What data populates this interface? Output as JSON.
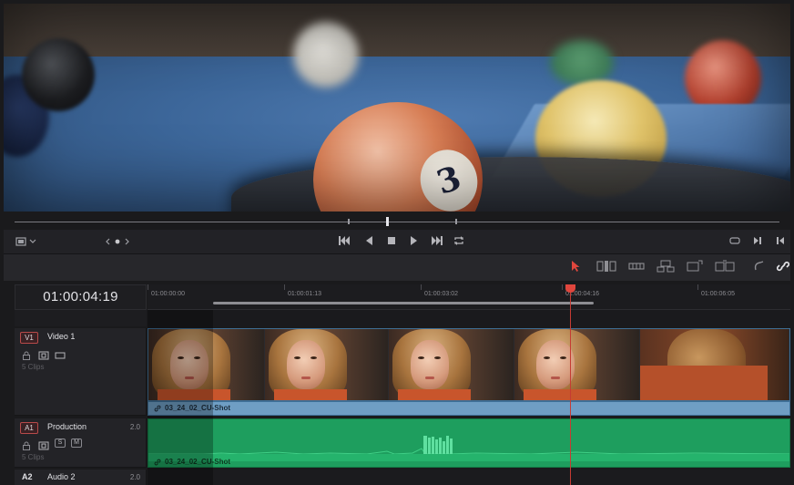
{
  "viewer": {
    "frame_number": "3"
  },
  "toolbar_icons": [
    "selection-arrow-icon",
    "trim-icon",
    "blade-icon",
    "insert-clip-icon",
    "overwrite-clip-icon",
    "replace-clip-icon",
    "snapping-icon",
    "linked-selection-icon"
  ],
  "timecode": {
    "current": "01:00:04:19"
  },
  "ruler": {
    "labels": [
      "01:00:00:00",
      "01:00:01:13",
      "01:00:03:02",
      "01:00:04:16",
      "01:00:06:05"
    ]
  },
  "tracks": {
    "v1": {
      "badge": "V1",
      "name": "Video 1",
      "clips": "5 Clips",
      "clip_name": "03_24_02_CU-Shot"
    },
    "a1": {
      "badge": "A1",
      "name": "Production",
      "channels": "2.0",
      "clips": "5 Clips",
      "clip_name": "03_24_02_CU-Shot",
      "solo": "S",
      "mute": "M"
    },
    "a2": {
      "badge": "A2",
      "name": "Audio 2",
      "channels": "2.0"
    }
  },
  "colors": {
    "playhead": "#e0463d",
    "video_clip": "#6f9ec4",
    "audio_clip": "#1e9e5e",
    "track_badge": "#b84a4a"
  }
}
